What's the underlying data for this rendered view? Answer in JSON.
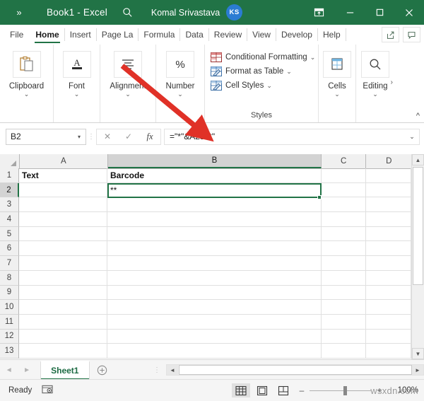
{
  "titlebar": {
    "qat_overflow": "»",
    "title": "Book1  -  Excel",
    "search_icon": "search-icon",
    "user_name": "Komal Srivastava",
    "avatar_initials": "KS",
    "ribbon_display_options": "ribbon-display-options-icon",
    "minimize": "–",
    "maximize": "▫",
    "close": "✕",
    "bg_color": "#217346"
  },
  "tabs": [
    {
      "label": "File",
      "selected": false
    },
    {
      "label": "Home",
      "selected": true
    },
    {
      "label": "Insert",
      "selected": false
    },
    {
      "label": "Page La",
      "selected": false
    },
    {
      "label": "Formula",
      "selected": false
    },
    {
      "label": "Data",
      "selected": false
    },
    {
      "label": "Review",
      "selected": false
    },
    {
      "label": "View",
      "selected": false
    },
    {
      "label": "Develop",
      "selected": false
    },
    {
      "label": "Help",
      "selected": false
    }
  ],
  "tab_actions": [
    {
      "name": "share-button",
      "icon": "share-icon"
    },
    {
      "name": "comments-button",
      "icon": "comment-icon"
    }
  ],
  "ribbon": {
    "groups": [
      {
        "label": "Clipboard",
        "icon": "clipboard-icon",
        "chevron": "⌄"
      },
      {
        "label": "Font",
        "icon": "font-icon",
        "chevron": "⌄"
      },
      {
        "label": "Alignment",
        "icon": "alignment-icon",
        "chevron": "⌄"
      },
      {
        "label": "Number",
        "icon": "percent-icon",
        "chevron": "⌄"
      }
    ],
    "styles": {
      "title": "Styles",
      "items": [
        {
          "label": "Conditional Formatting",
          "icon": "conditional-formatting-icon",
          "dropdown": "⌄"
        },
        {
          "label": "Format as Table",
          "icon": "format-as-table-icon",
          "dropdown": "⌄"
        },
        {
          "label": "Cell Styles",
          "icon": "cell-styles-icon",
          "dropdown": "⌄"
        }
      ]
    },
    "cells": {
      "label": "Cells",
      "icon": "cells-icon",
      "chevron": "⌄"
    },
    "editing": {
      "label": "Editing",
      "icon": "editing-search-icon",
      "chevron": "⌄",
      "overflow": "›"
    },
    "collapse": "^"
  },
  "formula_bar": {
    "name_box_value": "B2",
    "name_box_chevron": "▾",
    "cancel_icon": "✕",
    "confirm_icon": "✓",
    "fx_label": "fx",
    "formula": "=\"*\"&A2&\"*\"",
    "expand_chevron": "⌄"
  },
  "grid": {
    "columns": [
      {
        "label": "A",
        "selected": false
      },
      {
        "label": "B",
        "selected": true
      },
      {
        "label": "C",
        "selected": false
      },
      {
        "label": "D",
        "selected": false
      }
    ],
    "rows": [
      {
        "num": "1",
        "selected": false,
        "a": "Text",
        "b": "Barcode",
        "c": "",
        "d": "",
        "bold": true
      },
      {
        "num": "2",
        "selected": true,
        "a": "",
        "b": "**",
        "c": "",
        "d": "",
        "bold": false
      },
      {
        "num": "3",
        "selected": false,
        "a": "",
        "b": "",
        "c": "",
        "d": "",
        "bold": false
      },
      {
        "num": "4",
        "selected": false,
        "a": "",
        "b": "",
        "c": "",
        "d": "",
        "bold": false
      },
      {
        "num": "5",
        "selected": false,
        "a": "",
        "b": "",
        "c": "",
        "d": "",
        "bold": false
      },
      {
        "num": "6",
        "selected": false,
        "a": "",
        "b": "",
        "c": "",
        "d": "",
        "bold": false
      },
      {
        "num": "7",
        "selected": false,
        "a": "",
        "b": "",
        "c": "",
        "d": "",
        "bold": false
      },
      {
        "num": "8",
        "selected": false,
        "a": "",
        "b": "",
        "c": "",
        "d": "",
        "bold": false
      },
      {
        "num": "9",
        "selected": false,
        "a": "",
        "b": "",
        "c": "",
        "d": "",
        "bold": false
      },
      {
        "num": "10",
        "selected": false,
        "a": "",
        "b": "",
        "c": "",
        "d": "",
        "bold": false
      },
      {
        "num": "11",
        "selected": false,
        "a": "",
        "b": "",
        "c": "",
        "d": "",
        "bold": false
      },
      {
        "num": "12",
        "selected": false,
        "a": "",
        "b": "",
        "c": "",
        "d": "",
        "bold": false
      },
      {
        "num": "13",
        "selected": false,
        "a": "",
        "b": "",
        "c": "",
        "d": "",
        "bold": false
      }
    ],
    "active_cell": "B2",
    "selection_color": "#217346"
  },
  "sheet_bar": {
    "prev_arrow": "◄",
    "next_arrow": "►",
    "tabs": [
      {
        "label": "Sheet1",
        "active": true
      }
    ],
    "add_sheet": "＋",
    "scroll_left": "◄",
    "scroll_right": "►"
  },
  "status_bar": {
    "mode": "Ready",
    "macro_icon": "record-macro-icon",
    "views": [
      {
        "name": "normal-view-button",
        "icon": "grid-icon",
        "active": true
      },
      {
        "name": "page-layout-view-button",
        "icon": "page-layout-icon",
        "active": false
      },
      {
        "name": "page-break-view-button",
        "icon": "page-break-icon",
        "active": false
      }
    ],
    "zoom_out": "–",
    "zoom_in": "+",
    "zoom_level": "100%"
  },
  "annotation": {
    "arrow_color": "#e03127",
    "arrow_label": "red-arrow-pointing-to-formula-bar"
  },
  "watermark": {
    "text": "wsxdn.com"
  }
}
